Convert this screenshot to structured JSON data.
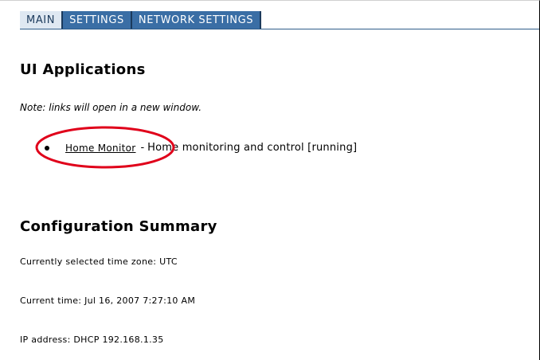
{
  "tabs": [
    {
      "label": "MAIN",
      "active": true
    },
    {
      "label": "SETTINGS",
      "active": false
    },
    {
      "label": "NETWORK SETTINGS",
      "active": false
    }
  ],
  "ui_applications": {
    "title": "UI Applications",
    "note": "Note: links will open in a new window.",
    "apps": [
      {
        "link_label": "Home Monitor",
        "separator": "-",
        "description": "Home monitoring and control [running]"
      }
    ]
  },
  "configuration_summary": {
    "title": "Configuration Summary",
    "time_zone": "Currently selected time zone: UTC",
    "current_time": "Current time: Jul 16, 2007 7:27:10 AM",
    "ip_address": "IP address: DHCP 192.168.1.35"
  },
  "colors": {
    "tab_bar": "#3a6ea5",
    "active_tab": "#dfe8f2",
    "highlight_ellipse": "#e0001a"
  }
}
